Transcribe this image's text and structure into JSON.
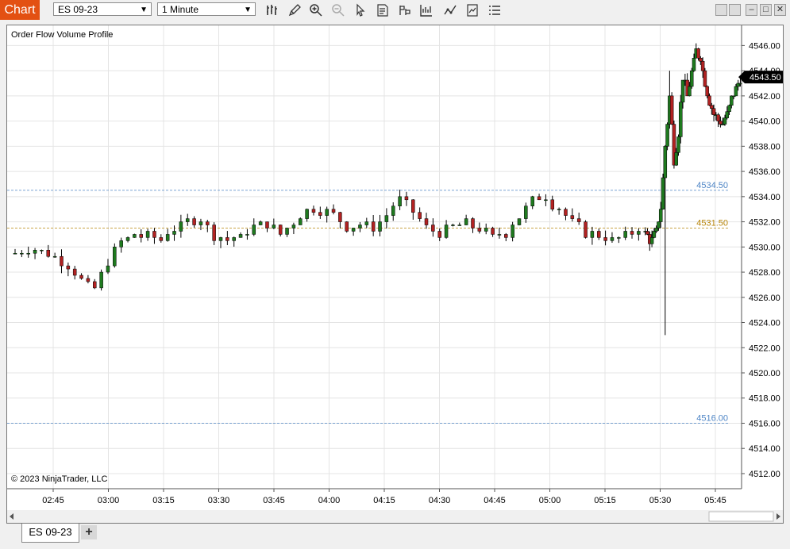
{
  "toolbar": {
    "chart_label": "Chart",
    "instrument": "ES 09-23",
    "interval": "1 Minute",
    "tools": [
      "bar-type-icon",
      "drawing-pencil-icon",
      "zoom-in-icon",
      "zoom-out-icon",
      "pointer-icon",
      "data-box-icon",
      "properties-icon",
      "indicators-icon",
      "strategies-icon",
      "templates-icon",
      "menu-list-icon"
    ]
  },
  "chart": {
    "indicator_label": "Order Flow Volume Profile",
    "copyright": "© 2023 NinjaTrader, LLC",
    "current_price_label": "4543.50",
    "colors": {
      "up": "#1f7a1f",
      "down": "#b22222",
      "wick": "#000000",
      "grid": "#e4e4e4",
      "line_blue": "#4f86c6",
      "line_gold": "#b8860b"
    }
  },
  "chart_data": {
    "type": "candlestick",
    "y_ticks": [
      "4546.00",
      "4544.00",
      "4542.00",
      "4540.00",
      "4538.00",
      "4536.00",
      "4534.00",
      "4532.00",
      "4530.00",
      "4528.00",
      "4526.00",
      "4524.00",
      "4522.00",
      "4520.00",
      "4518.00",
      "4516.00",
      "4514.00",
      "4512.00"
    ],
    "x_ticks": [
      "02:45",
      "03:00",
      "03:15",
      "03:30",
      "03:45",
      "04:00",
      "04:15",
      "04:30",
      "04:45",
      "05:00",
      "05:15",
      "05:30",
      "05:45"
    ],
    "ylim": [
      4510.8,
      4547.6
    ],
    "levels": [
      {
        "value": 4534.5,
        "label": "4534.50",
        "color": "#4f86c6"
      },
      {
        "value": 4531.5,
        "label": "4531.50",
        "color": "#b8860b"
      },
      {
        "value": 4516.0,
        "label": "4516.00",
        "color": "#4f86c6"
      }
    ],
    "last_price": 4543.5
  },
  "bottom": {
    "tab_label": "ES 09-23",
    "add_label": "+"
  }
}
